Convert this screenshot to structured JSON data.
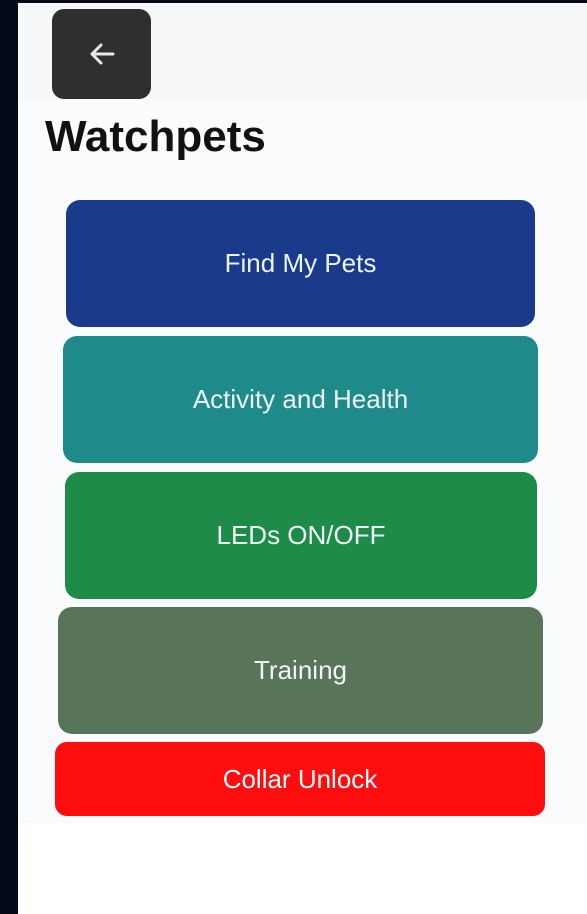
{
  "header": {
    "back_icon": "arrow-left-icon",
    "title": "Watchpets"
  },
  "menu": {
    "find_my_pets": {
      "label": "Find My Pets",
      "color": "#1a3a8c"
    },
    "activity_and_health": {
      "label": "Activity and Health",
      "color": "#1e8a8a"
    },
    "leds_on_off": {
      "label": "LEDs ON/OFF",
      "color": "#1e8c48"
    },
    "training": {
      "label": "Training",
      "color": "#58755a"
    },
    "collar_unlock": {
      "label": "Collar Unlock",
      "color": "#fd0d0d"
    }
  }
}
